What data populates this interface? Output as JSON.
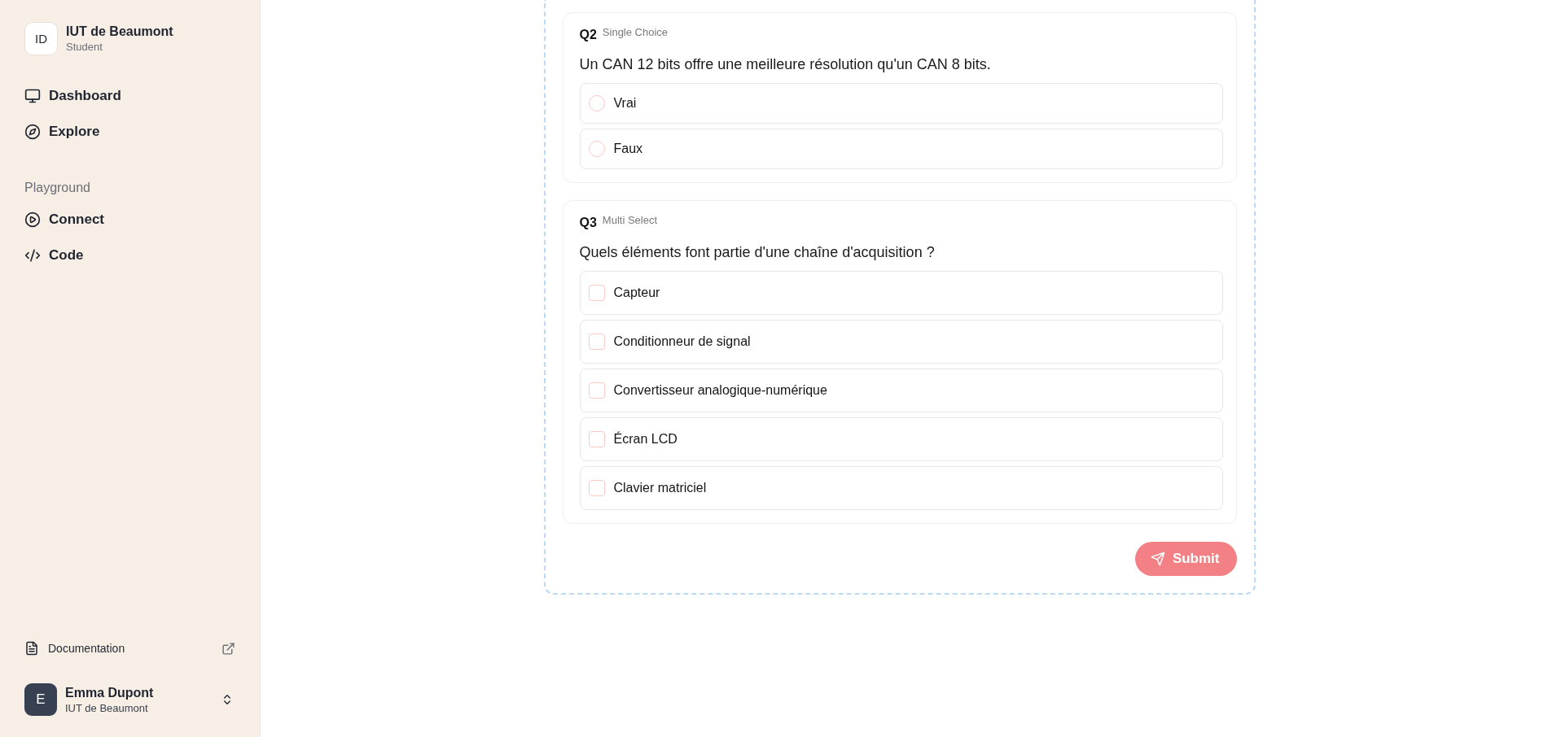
{
  "sidebar": {
    "org": {
      "initials": "ID",
      "name": "IUT de Beaumont",
      "role": "Student"
    },
    "nav": [
      {
        "label": "Dashboard"
      },
      {
        "label": "Explore"
      }
    ],
    "playground": {
      "heading": "Playground",
      "items": [
        {
          "label": "Connect"
        },
        {
          "label": "Code"
        }
      ]
    },
    "documentation": "Documentation",
    "user": {
      "initial": "E",
      "name": "Emma Dupont",
      "org": "IUT de Beaumont"
    }
  },
  "questions": [
    {
      "number": "Q2",
      "type_label": "Single Choice",
      "kind": "single",
      "text": "Un CAN 12 bits offre une meilleure résolution qu'un CAN 8 bits.",
      "options": [
        {
          "label": "Vrai",
          "selected": false
        },
        {
          "label": "Faux",
          "selected": false
        }
      ]
    },
    {
      "number": "Q3",
      "type_label": "Multi Select",
      "kind": "multi",
      "text": "Quels éléments font partie d'une chaîne d'acquisition ?",
      "options": [
        {
          "label": "Capteur",
          "checked": false
        },
        {
          "label": "Conditionneur de signal",
          "checked": false
        },
        {
          "label": "Convertisseur analogique-numérique",
          "checked": false
        },
        {
          "label": "Écran LCD",
          "checked": false
        },
        {
          "label": "Clavier matriciel",
          "checked": false
        }
      ]
    }
  ],
  "submit": "Submit"
}
